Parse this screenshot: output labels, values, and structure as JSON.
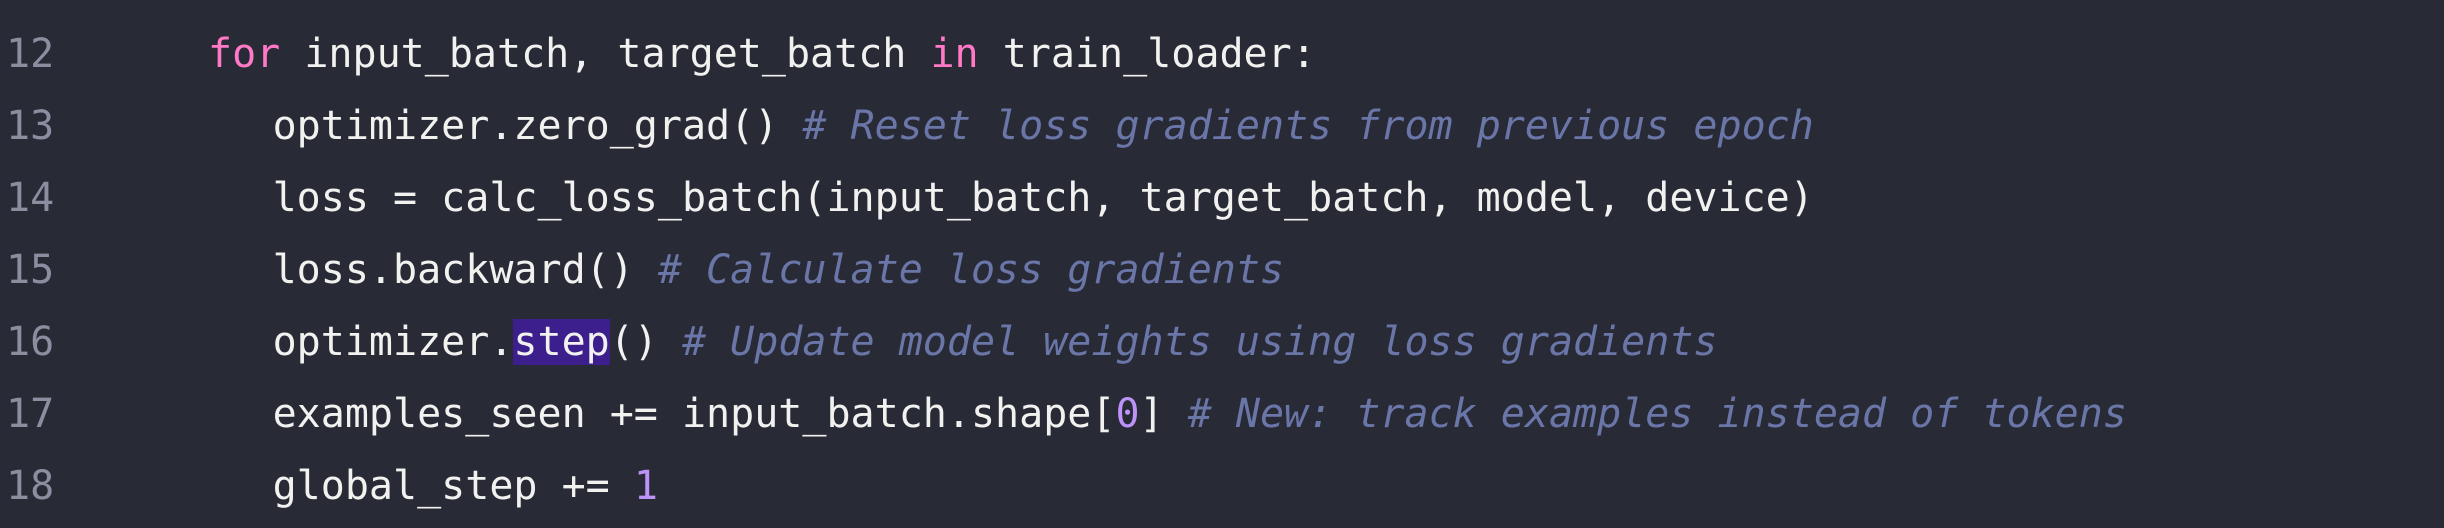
{
  "editor": {
    "lines": [
      {
        "number": "12",
        "indent": "            ",
        "tokens": [
          {
            "t": "for",
            "c": "kw"
          },
          {
            "t": " input_batch, target_batch ",
            "c": ""
          },
          {
            "t": "in",
            "c": "kw"
          },
          {
            "t": " train_loader:",
            "c": ""
          }
        ]
      },
      {
        "number": "13",
        "indent": "                ",
        "tokens": [
          {
            "t": "optimizer.zero_grad() ",
            "c": ""
          },
          {
            "t": "# Reset loss gradients from previous epoch",
            "c": "cm"
          }
        ]
      },
      {
        "number": "14",
        "indent": "                ",
        "tokens": [
          {
            "t": "loss = calc_loss_batch(input_batch, target_batch, model, device)",
            "c": ""
          }
        ]
      },
      {
        "number": "15",
        "indent": "                ",
        "tokens": [
          {
            "t": "loss.backward() ",
            "c": ""
          },
          {
            "t": "# Calculate loss gradients",
            "c": "cm"
          }
        ]
      },
      {
        "number": "16",
        "indent": "                ",
        "tokens": [
          {
            "t": "optimizer.",
            "c": ""
          },
          {
            "t": "step",
            "c": "hl"
          },
          {
            "t": "() ",
            "c": ""
          },
          {
            "t": "# Update model weights using loss gradients",
            "c": "cm"
          }
        ]
      },
      {
        "number": "17",
        "indent": "                ",
        "tokens": [
          {
            "t": "examples_seen += input_batch.shape[",
            "c": ""
          },
          {
            "t": "0",
            "c": "num"
          },
          {
            "t": "] ",
            "c": ""
          },
          {
            "t": "# New: track examples instead of tokens",
            "c": "cm"
          }
        ]
      },
      {
        "number": "18",
        "indent": "                ",
        "tokens": [
          {
            "t": "global_step += ",
            "c": ""
          },
          {
            "t": "1",
            "c": "num"
          }
        ]
      }
    ]
  },
  "colors": {
    "background": "#282a36",
    "keyword": "#ff79c6",
    "comment": "#6b76a8",
    "number": "#bd93f9",
    "selection": "#3c1f8c",
    "line_number": "#8b8ea0"
  }
}
